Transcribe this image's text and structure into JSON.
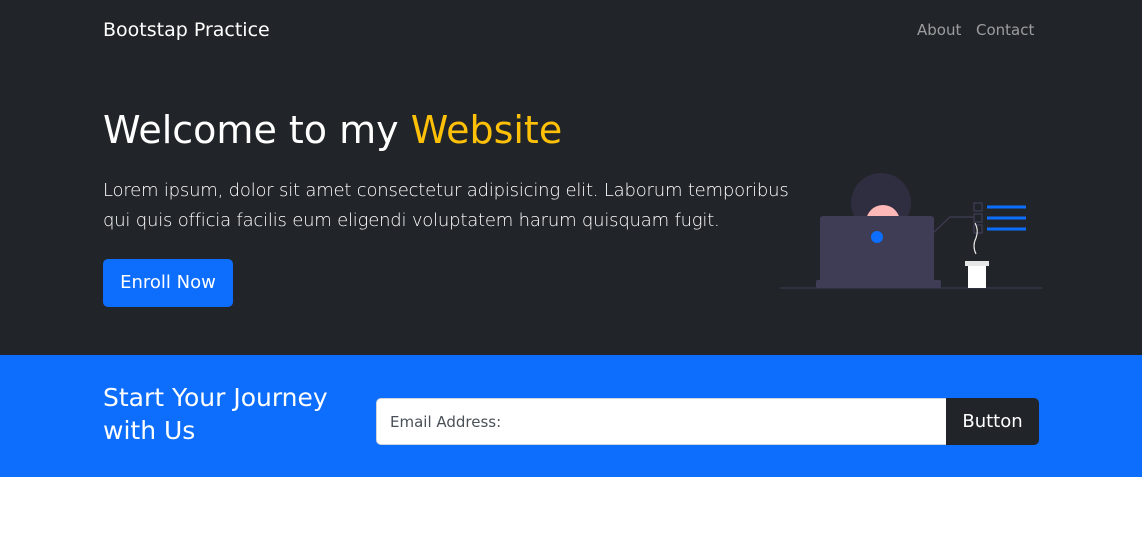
{
  "navbar": {
    "brand": "Bootstap Practice",
    "links": [
      {
        "label": "About"
      },
      {
        "label": "Contact"
      }
    ]
  },
  "hero": {
    "title_prefix": "Welcome to my ",
    "title_highlight": "Website",
    "lead": "Lorem ipsum, dolor sit amet consectetur adipisicing elit. Laborum temporibus qui quis officia facilis eum eligendi voluptatem harum quisquam fugit.",
    "enroll_label": "Enroll Now",
    "illustration_icon": "woman-at-laptop-illustration"
  },
  "journey": {
    "title": "Start Your Journey with Us",
    "email_placeholder": "Email Address:",
    "email_value": "",
    "button_label": "Button"
  },
  "colors": {
    "dark_bg": "#212529",
    "primary": "#0d6efd",
    "accent": "#ffc107",
    "white": "#ffffff",
    "nav_link": "rgba(255,255,255,0.55)"
  }
}
